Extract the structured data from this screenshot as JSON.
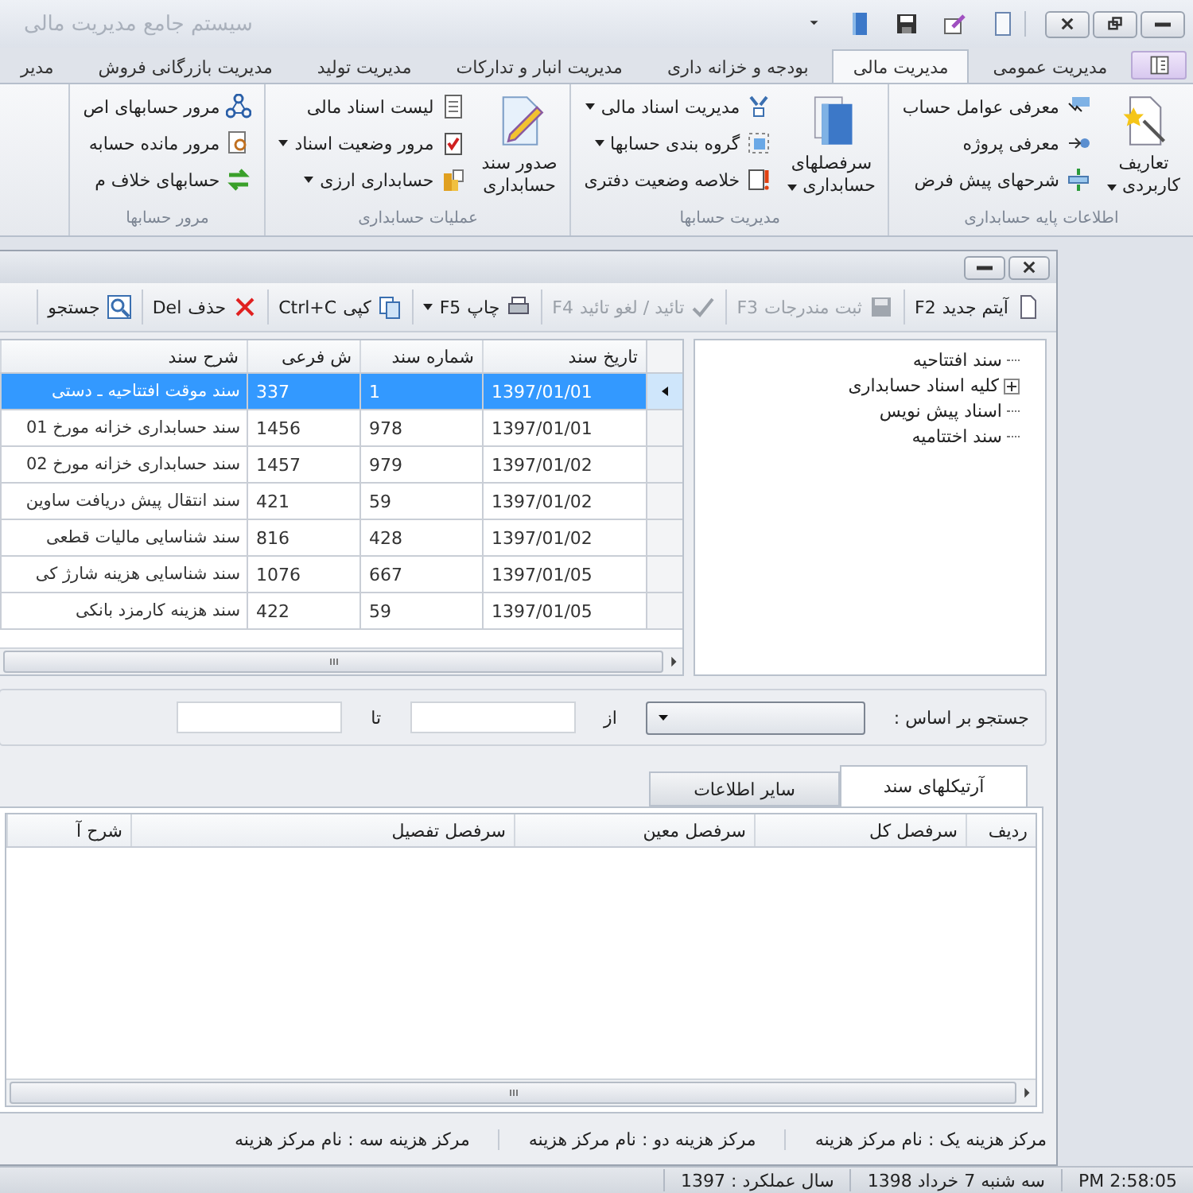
{
  "window": {
    "title": "سیستم جامع مدیریت مالی"
  },
  "ribbon_tabs": [
    {
      "label": "مدیریت عمومی",
      "selected": false
    },
    {
      "label": "مدیریت مالی",
      "selected": true
    },
    {
      "label": "بودجه و خزانه داری",
      "selected": false
    },
    {
      "label": "مدیریت انبار و تدارکات",
      "selected": false
    },
    {
      "label": "مدیریت تولید",
      "selected": false
    },
    {
      "label": "مدیریت بازرگانی فروش",
      "selected": false
    },
    {
      "label": "مدیر",
      "selected": false
    }
  ],
  "ribbon_groups": [
    {
      "title": "اطلاعات پایه حسابداری",
      "large": {
        "label": "تعاریف\nکاربردی",
        "dropdown": true
      },
      "items": [
        {
          "label": "معرفی عوامل حساب",
          "dropdown": false
        },
        {
          "label": "معرفی پروژه",
          "dropdown": false
        },
        {
          "label": "شرحهای پیش فرض",
          "dropdown": false
        }
      ]
    },
    {
      "title": "مدیریت حسابها",
      "large": {
        "label": "سرفصلهای\nحسابداری",
        "dropdown": true
      },
      "items": [
        {
          "label": "مدیریت اسناد مالی",
          "dropdown": true
        },
        {
          "label": "گروه بندی حسابها",
          "dropdown": true
        },
        {
          "label": "خلاصه وضعیت دفتری",
          "dropdown": false
        }
      ]
    },
    {
      "title": "عملیات حسابداری",
      "large": {
        "label": "صدور سند\nحسابداری",
        "dropdown": false
      },
      "items": [
        {
          "label": "لیست اسناد مالی",
          "dropdown": false
        },
        {
          "label": "مرور وضعیت اسناد",
          "dropdown": true
        },
        {
          "label": "حسابداری ارزی",
          "dropdown": true
        }
      ]
    },
    {
      "title": "مرور حسابها",
      "items": [
        {
          "label": "مرور حسابهای اص",
          "dropdown": false
        },
        {
          "label": "مرور مانده حسابه",
          "dropdown": false
        },
        {
          "label": "حسابهای خلاف م",
          "dropdown": false
        }
      ]
    }
  ],
  "toolbar": [
    {
      "label": "آیتم جدید",
      "key": "F2",
      "disabled": false,
      "dropdown": false
    },
    {
      "label": "ثبت مندرجات",
      "key": "F3",
      "disabled": true,
      "dropdown": false
    },
    {
      "label": "تائید / لغو تائید",
      "key": "F4",
      "disabled": true,
      "dropdown": false
    },
    {
      "label": "چاپ",
      "key": "F5",
      "disabled": false,
      "dropdown": true
    },
    {
      "label": "کپی",
      "key": "Ctrl+C",
      "disabled": false,
      "dropdown": false
    },
    {
      "label": "حذف",
      "key": "Del",
      "disabled": false,
      "dropdown": false
    },
    {
      "label": "جستجو",
      "disabled": false,
      "dropdown": false
    }
  ],
  "tree": [
    {
      "label": "سند افتتاحیه",
      "kind": "leaf"
    },
    {
      "label": "کلیه اسناد حسابداری",
      "kind": "folder",
      "expanded": false
    },
    {
      "label": "اسناد پیش نویس",
      "kind": "leaf"
    },
    {
      "label": "سند اختتامیه",
      "kind": "leaf"
    }
  ],
  "documents": {
    "columns": [
      "تاریخ سند",
      "شماره سند",
      "ش فرعی",
      "شرح سند"
    ],
    "rows": [
      {
        "date": "1397/01/01",
        "number": "1",
        "sub": "337",
        "description": "سند موقت افتتاحیه ـ دستی",
        "selected": true
      },
      {
        "date": "1397/01/01",
        "number": "978",
        "sub": "1456",
        "description": "سند حسابداری خزانه مورخ 01",
        "selected": false
      },
      {
        "date": "1397/01/02",
        "number": "979",
        "sub": "1457",
        "description": "سند حسابداری خزانه مورخ 02",
        "selected": false
      },
      {
        "date": "1397/01/02",
        "number": "59",
        "sub": "421",
        "description": "سند انتقال پیش دریافت ساوین",
        "selected": false
      },
      {
        "date": "1397/01/02",
        "number": "428",
        "sub": "816",
        "description": "سند شناسایی مالیات قطعی",
        "selected": false
      },
      {
        "date": "1397/01/05",
        "number": "667",
        "sub": "1076",
        "description": "سند شناسایی هزینه شارژ کی",
        "selected": false
      },
      {
        "date": "1397/01/05",
        "number": "59",
        "sub": "422",
        "description": "سند هزینه کارمزد بانکی",
        "selected": false
      }
    ]
  },
  "search": {
    "label": "جستجو بر  اساس :",
    "from_label": "از",
    "to_label": "تا"
  },
  "detail_tabs": [
    {
      "label": "آرتیکلهای سند",
      "selected": true
    },
    {
      "label": "سایر اطلاعات",
      "selected": false
    }
  ],
  "articles": {
    "columns": [
      "ردیف",
      "سرفصل کل",
      "سرفصل معین",
      "سرفصل تفصیل",
      "شرح آ"
    ]
  },
  "cost_centers": [
    {
      "label": "مرکز هزینه یک :",
      "value": "نام مرکز هزینه"
    },
    {
      "label": "مرکز هزینه دو :",
      "value": "نام مرکز هزینه"
    },
    {
      "label": "مرکز هزینه سه :",
      "value": "نام مرکز هزینه"
    }
  ],
  "status_bar": {
    "time": "PM 2:58:05",
    "date": "سه شنبه 7 خرداد 1398",
    "year_label": "سال عملکرد :",
    "year": "1397"
  }
}
